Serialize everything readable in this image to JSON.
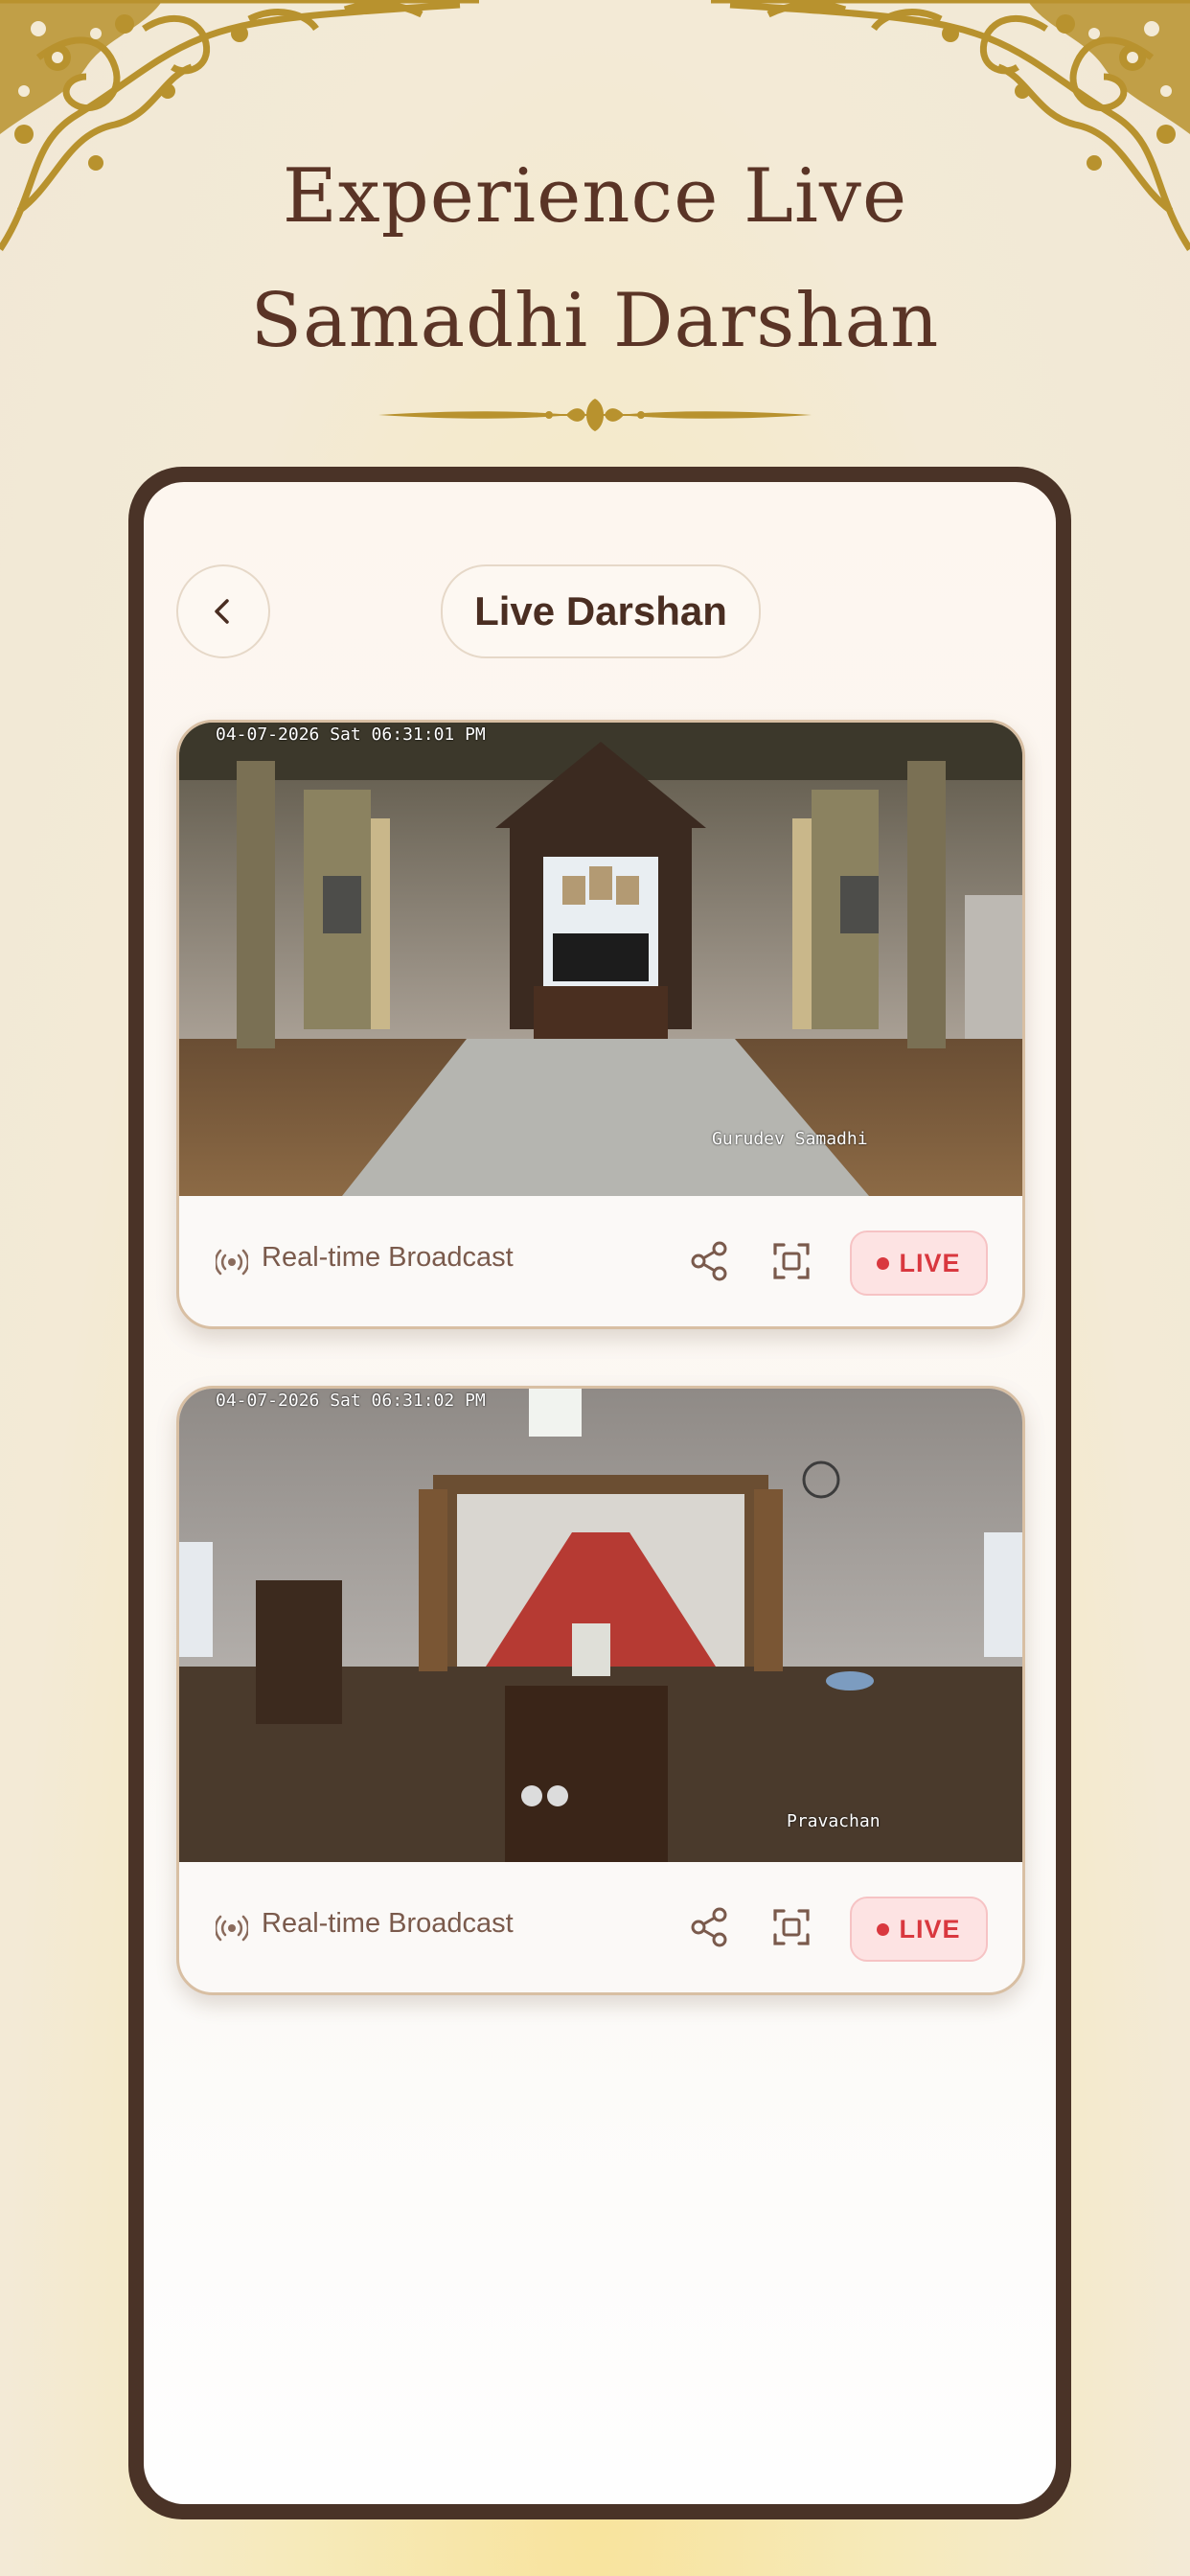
{
  "headline": {
    "line1": "Experience Live",
    "line2": "Samadhi Darshan"
  },
  "header": {
    "title": "Live Darshan",
    "back_icon": "chevron-left-icon"
  },
  "streams": [
    {
      "timestamp": "04-07-2026 Sat 06:31:01 PM",
      "camera_label": "Gurudev Samadhi",
      "broadcast_label": "Real-time Broadcast",
      "live_label": "LIVE"
    },
    {
      "timestamp": "04-07-2026 Sat 06:31:02 PM",
      "camera_label": "Pravachan",
      "broadcast_label": "Real-time Broadcast",
      "live_label": "LIVE"
    }
  ],
  "colors": {
    "brand_brown": "#4a3327",
    "gold": "#b8922e",
    "live_red": "#d9383f",
    "live_bg": "#fde3e3"
  }
}
